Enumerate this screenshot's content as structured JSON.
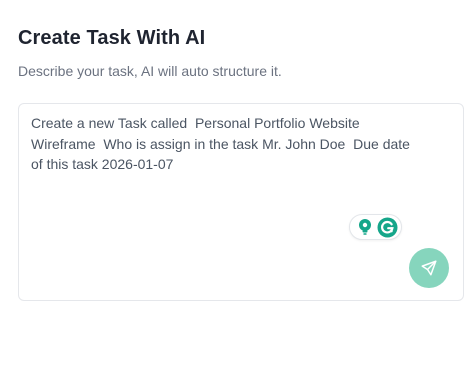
{
  "header": {
    "title": "Create Task With AI",
    "subtitle": "Describe your task, AI will auto structure it."
  },
  "task_input": {
    "value": "Create a new Task called  Personal Portfolio Website Wireframe  Who is assign in the task Mr. John Doe  Due date of this task 2026-01-07"
  },
  "grammarly": {
    "icons": [
      "lightbulb-icon",
      "grammarly-g-icon"
    ],
    "colors": {
      "bulb": "#15a68a",
      "g": "#15a68a"
    }
  },
  "send_button": {
    "icon": "send-icon",
    "color": "#86d5bd"
  },
  "colors": {
    "title": "#1f2430",
    "subtitle": "#6b7280",
    "border": "#e5e7eb",
    "accent": "#86d5bd"
  }
}
